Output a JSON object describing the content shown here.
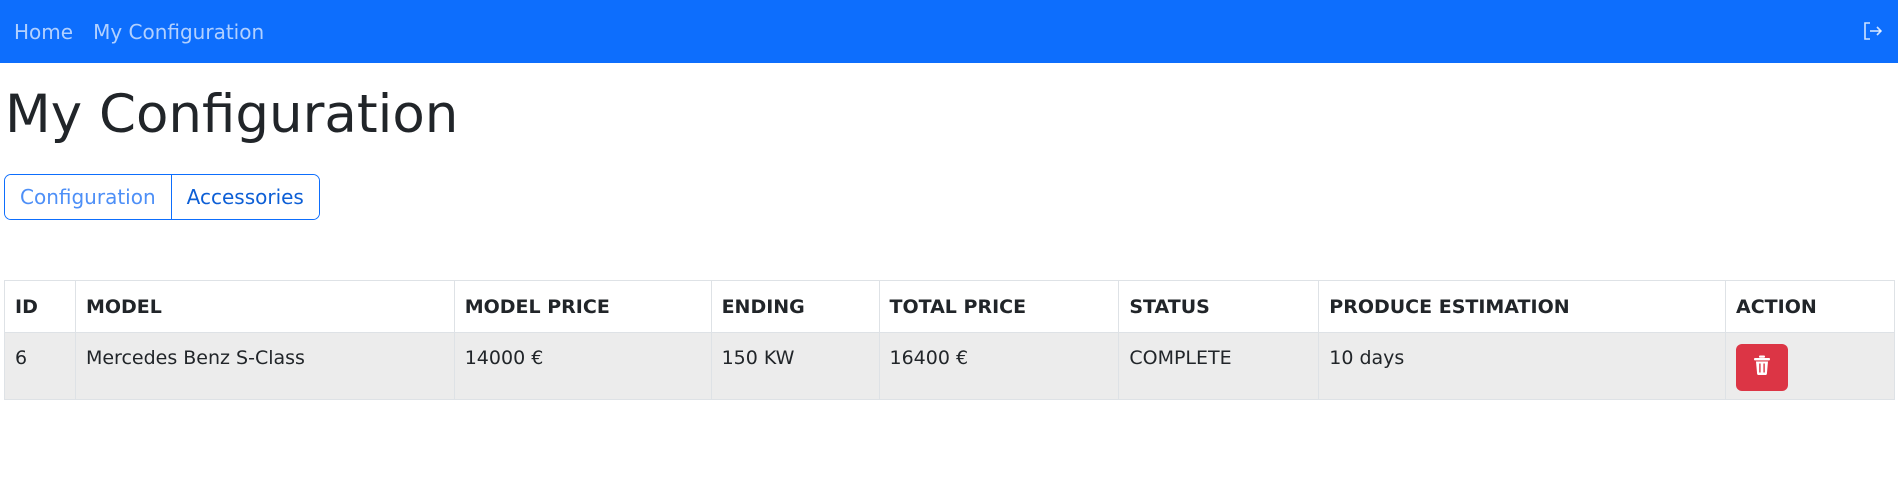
{
  "nav": {
    "links": [
      "Home",
      "My Configuration"
    ],
    "logout_icon": "logout-icon"
  },
  "page": {
    "title": "My Configuration"
  },
  "tabs": [
    {
      "label": "Configuration",
      "active": false
    },
    {
      "label": "Accessories",
      "active": true
    }
  ],
  "table": {
    "headers": [
      "ID",
      "MODEL",
      "MODEL PRICE",
      "ENDING",
      "TOTAL PRICE",
      "STATUS",
      "PRODUCE ESTIMATION",
      "ACTION"
    ],
    "rows": [
      {
        "id": "6",
        "model": "Mercedes Benz S-Class",
        "model_price": "14000 €",
        "ending": "150 KW",
        "total_price": "16400 €",
        "status": "COMPLETE",
        "produce_estimation": "10 days",
        "action_icon": "trash-icon"
      }
    ]
  },
  "colors": {
    "navbar": "#0d6efd",
    "danger": "#dc3545",
    "row_bg": "#ececec"
  }
}
